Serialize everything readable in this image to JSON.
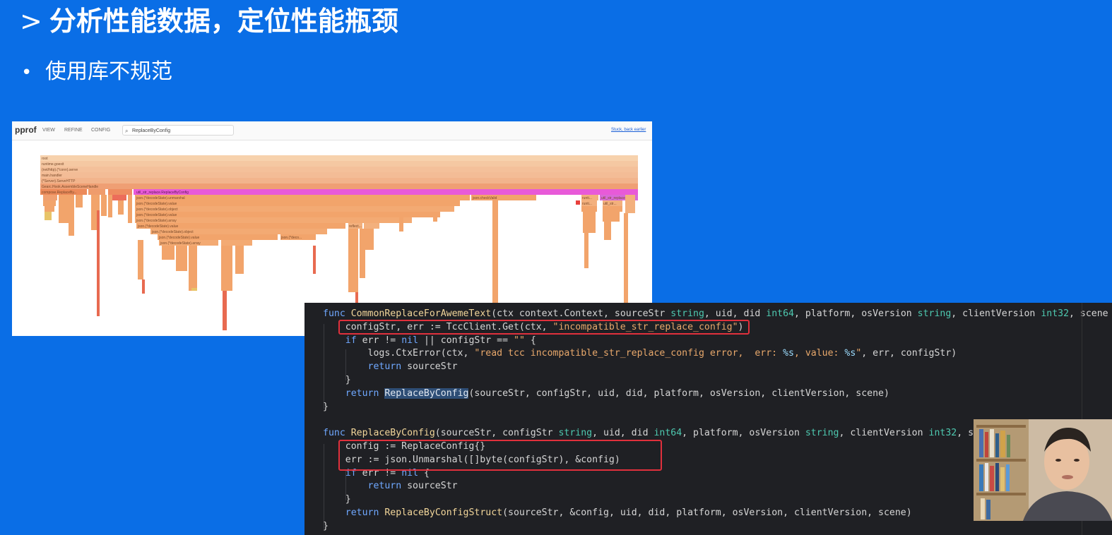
{
  "slide": {
    "title_chevron": ">",
    "title": "分析性能数据，定位性能瓶颈",
    "bullet": "•",
    "subtitle": "使用库不规范"
  },
  "pprof": {
    "logo": "pprof",
    "menu": [
      "VIEW",
      "REFINE",
      "CONFIG"
    ],
    "search_value": "ReplaceByConfig",
    "search_icon": "search-icon",
    "right_link": "Stuck, back earlier",
    "frames": {
      "root": "root",
      "f1": "runtime.goexit",
      "f2": "(net/http).(*conn).serve",
      "f3": "main.handler",
      "f4": "(*Server).ServeHTTP",
      "f5": "Gearc.Hook.AssembleSceneHandle",
      "f6": "compose.ReplaceBy...",
      "f7": "json.(*decodeState).unmarshal",
      "f8": "json.(*decodeState).value",
      "f9": "json.(*decodeState).object",
      "f10": "json.(*decodeState).value",
      "f11": "json.(*decodeState).array",
      "f12": "json.(*decodeState).value",
      "f13": "json.(*decodeState).object",
      "f14": "json.(*decodeState).value",
      "f15": "json.(*decodeState).array",
      "pink": "util_str_replace.ReplaceByConfig",
      "mid1": "json.checkValid",
      "side1": "util_str_replace...",
      "side2": "runti...",
      "side3": "util_str...",
      "side4": "runti...",
      "mid2": "reflect...",
      "mid3": "json.(*deco..."
    }
  },
  "code": {
    "lines": [
      {
        "parts": [
          {
            "t": "func ",
            "c": "kw2"
          },
          {
            "t": "CommonReplaceForAwemeText",
            "c": "fn"
          },
          {
            "t": "(ctx context.Context, sourceStr ",
            "c": ""
          },
          {
            "t": "string",
            "c": "ty"
          },
          {
            "t": ", uid, did ",
            "c": ""
          },
          {
            "t": "int64",
            "c": "ty"
          },
          {
            "t": ", platform, osVersion ",
            "c": ""
          },
          {
            "t": "string",
            "c": "ty"
          },
          {
            "t": ", clientVersion ",
            "c": ""
          },
          {
            "t": "int32",
            "c": "ty"
          },
          {
            "t": ", scene R",
            "c": ""
          }
        ]
      },
      {
        "parts": [
          {
            "t": "    configStr, err := TccClient.Get(ctx, ",
            "c": ""
          },
          {
            "t": "\"incompatible_str_replace_config\"",
            "c": "str"
          },
          {
            "t": ")",
            "c": ""
          }
        ]
      },
      {
        "parts": [
          {
            "t": "    ",
            "c": ""
          },
          {
            "t": "if",
            "c": "kw2"
          },
          {
            "t": " err != ",
            "c": ""
          },
          {
            "t": "nil",
            "c": "kw2"
          },
          {
            "t": " || configStr == ",
            "c": ""
          },
          {
            "t": "\"\"",
            "c": "str"
          },
          {
            "t": " {",
            "c": ""
          }
        ]
      },
      {
        "parts": [
          {
            "t": "        logs.CtxError(ctx, ",
            "c": ""
          },
          {
            "t": "\"read tcc incompatible_str_replace_config error,  err: ",
            "c": "str"
          },
          {
            "t": "%s",
            "c": "pct"
          },
          {
            "t": ", value: ",
            "c": "str"
          },
          {
            "t": "%s",
            "c": "pct"
          },
          {
            "t": "\"",
            "c": "str"
          },
          {
            "t": ", err, configStr)",
            "c": ""
          }
        ]
      },
      {
        "parts": [
          {
            "t": "        ",
            "c": ""
          },
          {
            "t": "return",
            "c": "kw2"
          },
          {
            "t": " sourceStr",
            "c": ""
          }
        ]
      },
      {
        "parts": [
          {
            "t": "    }",
            "c": ""
          }
        ]
      },
      {
        "parts": [
          {
            "t": "    ",
            "c": ""
          },
          {
            "t": "return",
            "c": "kw2"
          },
          {
            "t": " ",
            "c": ""
          },
          {
            "t": "ReplaceByConfig",
            "c": "fn hl"
          },
          {
            "t": "(sourceStr, configStr, uid, did, platform, osVersion, clientVersion, scene)",
            "c": ""
          }
        ]
      },
      {
        "parts": [
          {
            "t": "}",
            "c": ""
          }
        ]
      },
      {
        "parts": [
          {
            "t": "",
            "c": ""
          }
        ]
      },
      {
        "parts": [
          {
            "t": "func ",
            "c": "kw2"
          },
          {
            "t": "ReplaceByConfig",
            "c": "fn"
          },
          {
            "t": "(sourceStr, configStr ",
            "c": ""
          },
          {
            "t": "string",
            "c": "ty"
          },
          {
            "t": ", uid, did ",
            "c": ""
          },
          {
            "t": "int64",
            "c": "ty"
          },
          {
            "t": ", platform, osVersion ",
            "c": ""
          },
          {
            "t": "string",
            "c": "ty"
          },
          {
            "t": ", clientVersion ",
            "c": ""
          },
          {
            "t": "int32",
            "c": "ty"
          },
          {
            "t": ", scene R",
            "c": ""
          }
        ]
      },
      {
        "parts": [
          {
            "t": "    config := ReplaceConfig{}",
            "c": ""
          }
        ]
      },
      {
        "parts": [
          {
            "t": "    err := json.Unmarshal([]byte(configStr), &config)",
            "c": ""
          }
        ]
      },
      {
        "parts": [
          {
            "t": "    ",
            "c": ""
          },
          {
            "t": "if",
            "c": "kw2"
          },
          {
            "t": " err != ",
            "c": ""
          },
          {
            "t": "nil",
            "c": "kw2"
          },
          {
            "t": " {",
            "c": ""
          }
        ]
      },
      {
        "parts": [
          {
            "t": "        ",
            "c": ""
          },
          {
            "t": "return",
            "c": "kw2"
          },
          {
            "t": " sourceStr",
            "c": ""
          }
        ]
      },
      {
        "parts": [
          {
            "t": "    }",
            "c": ""
          }
        ]
      },
      {
        "parts": [
          {
            "t": "    ",
            "c": ""
          },
          {
            "t": "return",
            "c": "kw2"
          },
          {
            "t": " ",
            "c": ""
          },
          {
            "t": "ReplaceByConfigStruct",
            "c": "fn"
          },
          {
            "t": "(sourceStr, &config, uid, did, platform, osVersion, clientVersion, scene)",
            "c": ""
          }
        ]
      },
      {
        "parts": [
          {
            "t": "}",
            "c": ""
          }
        ]
      }
    ]
  },
  "colors": {
    "slide_bg": "#0a6ee6",
    "highlight_box": "#e0303c",
    "flame_pink": "#e85ad8",
    "flame_orange": "#f2a46b"
  }
}
